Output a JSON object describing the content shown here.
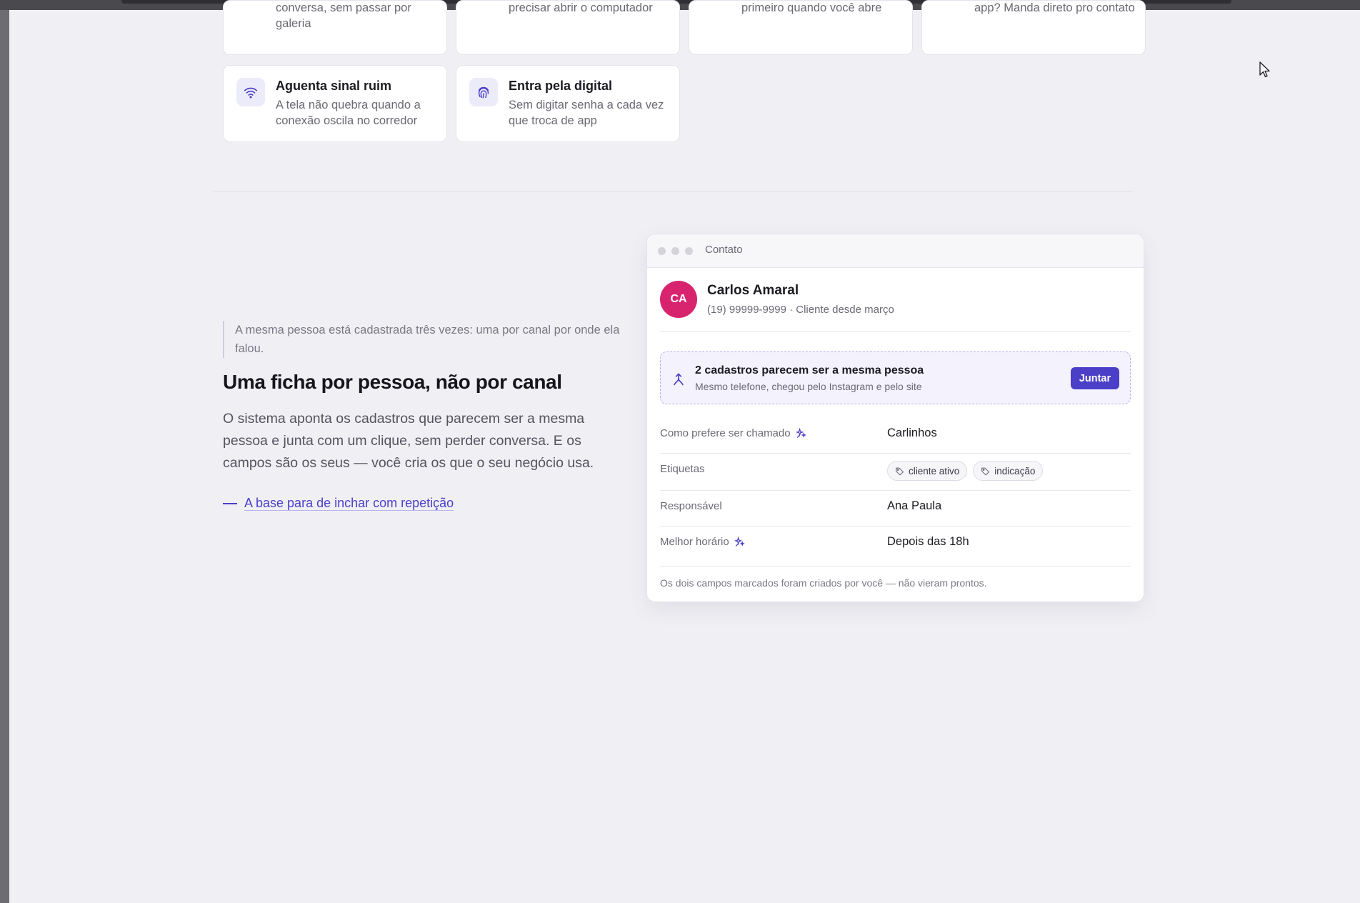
{
  "features_top": [
    {
      "desc_lines": [
        "conversa, sem passar por",
        "galeria"
      ]
    },
    {
      "desc_lines": [
        "precisar abrir o computador"
      ]
    },
    {
      "desc_lines": [
        "primeiro quando você abre"
      ]
    },
    {
      "desc_lines": [
        "app? Manda direto pro contato"
      ]
    }
  ],
  "features": [
    {
      "icon": "wifi-icon",
      "title": "Aguenta sinal ruim",
      "desc_lines": [
        "A tela não quebra quando a",
        "conexão oscila no corredor"
      ]
    },
    {
      "icon": "fingerprint-icon",
      "title": "Entra pela digital",
      "desc_lines": [
        "Sem digitar senha a cada vez",
        "que troca de app"
      ]
    }
  ],
  "section": {
    "quote": "A mesma pessoa está cadastrada três vezes: uma por canal por onde ela falou.",
    "headline": "Uma ficha por pessoa, não por canal",
    "body": "O sistema aponta os cadastros que parecem ser a mesma pessoa e junta com um clique, sem perder conversa. E os campos são os seus — você cria os que o seu negócio usa.",
    "link": "A base para de inchar com repetição"
  },
  "contact_window": {
    "title": "Contato",
    "avatar_initials": "CA",
    "avatar_color": "#d8236f",
    "name": "Carlos Amaral",
    "meta": "(19) 99999-9999 · Cliente desde março",
    "duplicate": {
      "title": "2 cadastros parecem ser a mesma pessoa",
      "subtitle": "Mesmo telefone, chegou pelo Instagram e pelo site",
      "button": "Juntar"
    },
    "fields": {
      "nickname": {
        "label": "Como prefere ser chamado",
        "value": "Carlinhos",
        "custom": true
      },
      "tags": {
        "label": "Etiquetas",
        "values": [
          "cliente ativo",
          "indicação"
        ]
      },
      "owner": {
        "label": "Responsável",
        "value": "Ana Paula"
      },
      "best_time": {
        "label": "Melhor horário",
        "value": "Depois das 18h",
        "custom": true
      }
    },
    "footnote": "Os dois campos marcados foram criados por você — não vieram prontos."
  },
  "colors": {
    "accent": "#4b3fc8",
    "avatar": "#d8236f",
    "background": "#f0f0f4"
  }
}
